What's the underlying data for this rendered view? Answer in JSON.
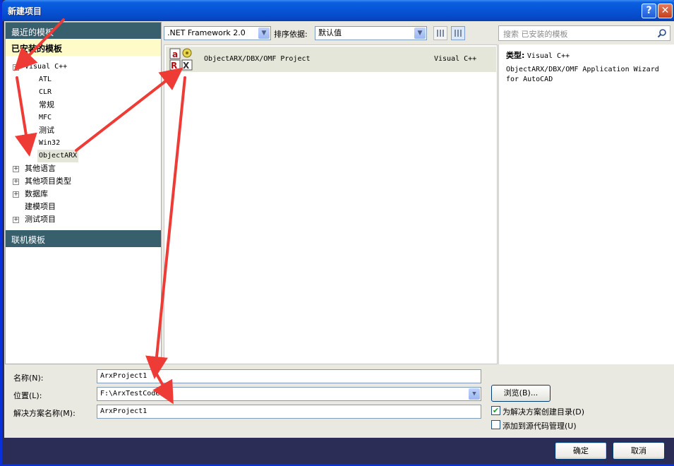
{
  "window": {
    "title": "新建项目",
    "help_glyph": "?",
    "close_glyph": "✕"
  },
  "left_pane": {
    "recent_header": "最近的模板",
    "installed_header": "已安装的模板",
    "tree": [
      {
        "label": "Visual C++",
        "expander": "−"
      },
      {
        "label": "ATL"
      },
      {
        "label": "CLR"
      },
      {
        "label": "常规"
      },
      {
        "label": "MFC"
      },
      {
        "label": "测试"
      },
      {
        "label": "Win32"
      },
      {
        "label": "ObjectARX"
      },
      {
        "label": "其他语言",
        "expander": "+"
      },
      {
        "label": "其他项目类型",
        "expander": "+"
      },
      {
        "label": "数据库",
        "expander": "+"
      },
      {
        "label": "建模项目"
      },
      {
        "label": "测试项目",
        "expander": "+"
      }
    ],
    "online_header": "联机模板"
  },
  "toolbar": {
    "framework": ".NET Framework 2.0",
    "sort_label": "排序依据:",
    "sort_value": "默认值"
  },
  "search": {
    "placeholder": "搜索 已安装的模板"
  },
  "templates": [
    {
      "name": "ObjectARX/DBX/OMF Project",
      "type": "Visual C++"
    }
  ],
  "details": {
    "type_label": "类型:",
    "type_value": "Visual C++",
    "description": "ObjectARX/DBX/OMF Application Wizard for AutoCAD"
  },
  "form": {
    "name_label": "名称(N):",
    "name_value": "ArxProject1",
    "location_label": "位置(L):",
    "location_value": "F:\\ArxTestCode\\",
    "solution_label": "解决方案名称(M):",
    "solution_value": "ArxProject1",
    "browse_label": "浏览(B)...",
    "create_dir_label": "为解决方案创建目录(D)",
    "create_dir_checked": true,
    "source_control_label": "添加到源代码管理(U)",
    "source_control_checked": false
  },
  "buttons": {
    "ok": "确定",
    "cancel": "取消"
  },
  "colors": {
    "title_bar": "#0754d6",
    "section_header": "#375f6c",
    "installed_highlight": "#fffbc8",
    "selection": "#e3e6d8",
    "annotation_arrow": "#ef3b36",
    "footer": "#2b2d57"
  }
}
